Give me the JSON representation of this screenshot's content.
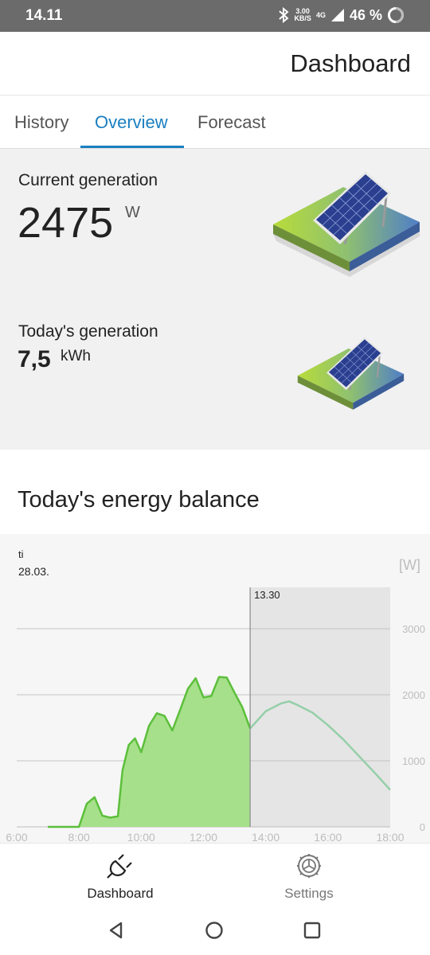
{
  "status_bar": {
    "time": "14.11",
    "net_speed_top": "3.00",
    "net_speed_bottom": "KB/S",
    "network": "4G",
    "battery": "46 %"
  },
  "app_bar": {
    "title": "Dashboard"
  },
  "tabs": [
    {
      "label": "History",
      "active": false
    },
    {
      "label": "Overview",
      "active": true
    },
    {
      "label": "Forecast",
      "active": false
    }
  ],
  "overview": {
    "current_label": "Current generation",
    "current_value": "2475",
    "current_unit": "W",
    "today_label": "Today's generation",
    "today_value": "7,5",
    "today_unit": "kWh"
  },
  "balance": {
    "title": "Today's energy balance"
  },
  "chart_data": {
    "type": "area",
    "day_label": "ti",
    "date_label": "28.03.",
    "y_unit": "[W]",
    "now_marker": "13.30",
    "x_ticks": [
      "6:00",
      "8:00",
      "10:00",
      "12:00",
      "14:00",
      "16:00",
      "18:00"
    ],
    "y_ticks": [
      "0",
      "1000",
      "2000",
      "3000"
    ],
    "ylim": [
      0,
      3000
    ],
    "xlim": [
      6,
      18
    ],
    "grid": true,
    "colors": {
      "actual_fill": "#a6e08a",
      "actual_line": "#5cbf3c",
      "forecast_line": "#95cfa9",
      "future_shade": "#e5e5e5"
    },
    "series": [
      {
        "x": [
          7.0,
          7.6,
          7.9,
          8.0,
          8.25,
          8.5,
          8.75,
          9.0,
          9.25,
          9.4,
          9.6,
          9.8,
          10.0,
          10.25,
          10.5,
          10.75,
          11.0,
          11.25,
          11.5,
          11.75,
          12.0,
          12.25,
          12.5,
          12.75,
          13.0,
          13.25,
          13.5
        ],
        "values": [
          0,
          0,
          0,
          0,
          350,
          450,
          170,
          140,
          160,
          860,
          1240,
          1340,
          1130,
          1530,
          1720,
          1680,
          1460,
          1770,
          2090,
          2250,
          1960,
          1980,
          2270,
          2260,
          2030,
          1810,
          1490
        ]
      },
      {
        "x": [
          13.5,
          14.0,
          14.5,
          14.75,
          15.0,
          15.5,
          16.0,
          16.5,
          17.0,
          17.5,
          18.0
        ],
        "values": [
          1490,
          1750,
          1870,
          1900,
          1850,
          1730,
          1540,
          1320,
          1070,
          820,
          560
        ]
      }
    ]
  },
  "nav": {
    "dashboard_label": "Dashboard",
    "settings_label": "Settings"
  }
}
